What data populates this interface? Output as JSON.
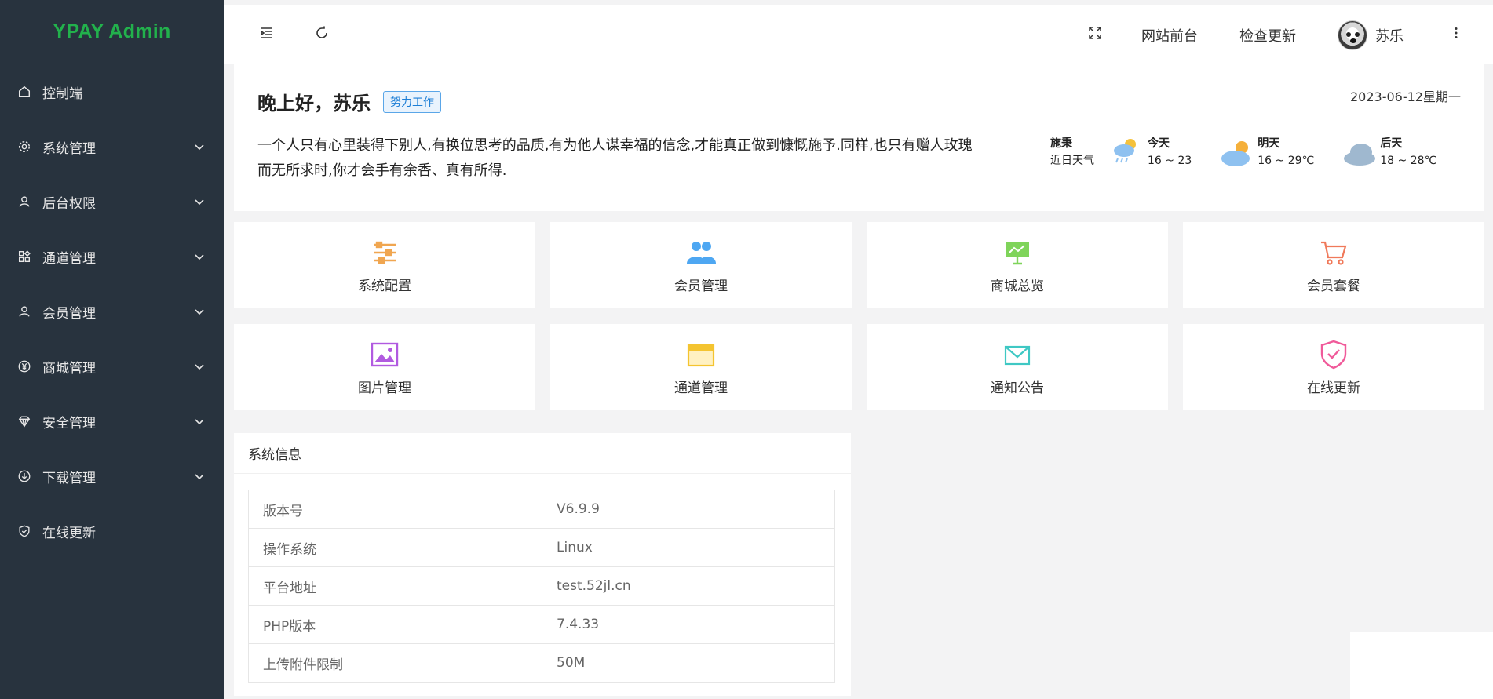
{
  "app": {
    "logo": "YPAY Admin"
  },
  "sidebar": {
    "items": [
      {
        "label": "控制端",
        "icon": "home-icon",
        "has_children": false
      },
      {
        "label": "系统管理",
        "icon": "gear-icon",
        "has_children": true
      },
      {
        "label": "后台权限",
        "icon": "user-icon",
        "has_children": true
      },
      {
        "label": "通道管理",
        "icon": "apps-icon",
        "has_children": true
      },
      {
        "label": "会员管理",
        "icon": "user-icon",
        "has_children": true
      },
      {
        "label": "商城管理",
        "icon": "yen-icon",
        "has_children": true
      },
      {
        "label": "安全管理",
        "icon": "diamond-icon",
        "has_children": true
      },
      {
        "label": "下载管理",
        "icon": "download-icon",
        "has_children": true
      },
      {
        "label": "在线更新",
        "icon": "shield-check-icon",
        "has_children": false
      }
    ]
  },
  "header": {
    "site_front": "网站前台",
    "check_update": "检查更新",
    "username": "苏乐"
  },
  "welcome": {
    "greeting": "晚上好，苏乐",
    "badge": "努力工作",
    "date": "2023-06-12星期一",
    "quote": "一个人只有心里装得下别人,有换位思考的品质,有为他人谋幸福的信念,才能真正做到慷慨施予.同样,也只有赠人玫瑰而无所求时,你才会手有余香、真有所得."
  },
  "weather": {
    "location": "施秉",
    "location_sub": "近日天气",
    "days": [
      {
        "label": "今天",
        "temp": "16 ~ 23",
        "icon": "rain-cloud-sun-icon"
      },
      {
        "label": "明天",
        "temp": "16 ~ 29℃",
        "icon": "partly-cloudy-icon"
      },
      {
        "label": "后天",
        "temp": "18 ~ 28℃",
        "icon": "cloud-icon"
      }
    ]
  },
  "shortcuts": [
    {
      "label": "系统配置",
      "icon": "sliders-icon",
      "color": "#f0a650"
    },
    {
      "label": "会员管理",
      "icon": "users-icon",
      "color": "#4ea7f2"
    },
    {
      "label": "商城总览",
      "icon": "presentation-icon",
      "color": "#7fd45a"
    },
    {
      "label": "会员套餐",
      "icon": "cart-icon",
      "color": "#f0795a"
    },
    {
      "label": "图片管理",
      "icon": "image-icon",
      "color": "#b15ae0"
    },
    {
      "label": "通道管理",
      "icon": "card-icon",
      "color": "#f4c430"
    },
    {
      "label": "通知公告",
      "icon": "mail-icon",
      "color": "#3fc8c4"
    },
    {
      "label": "在线更新",
      "icon": "shield-check-icon",
      "color": "#f05a9a"
    }
  ],
  "sysinfo": {
    "title": "系统信息",
    "rows": [
      {
        "key": "版本号",
        "value": "V6.9.9"
      },
      {
        "key": "操作系统",
        "value": "Linux"
      },
      {
        "key": "平台地址",
        "value": "test.52jl.cn"
      },
      {
        "key": "PHP版本",
        "value": "7.4.33"
      },
      {
        "key": "上传附件限制",
        "value": "50M"
      }
    ]
  }
}
